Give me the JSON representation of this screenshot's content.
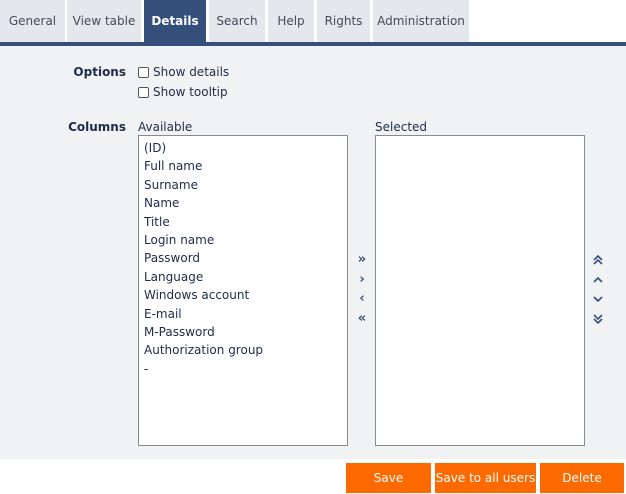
{
  "tabs": [
    {
      "label": "General",
      "active": false
    },
    {
      "label": "View table",
      "active": false
    },
    {
      "label": "Details",
      "active": true
    },
    {
      "label": "Search",
      "active": false
    },
    {
      "label": "Help",
      "active": false
    },
    {
      "label": "Rights",
      "active": false
    },
    {
      "label": "Administration",
      "active": false
    }
  ],
  "options": {
    "label": "Options",
    "show_details": {
      "label": "Show details",
      "checked": false
    },
    "show_tooltip": {
      "label": "Show tooltip",
      "checked": false
    }
  },
  "columns": {
    "label": "Columns",
    "available_caption": "Available",
    "selected_caption": "Selected",
    "available": [
      "(ID)",
      "Full name",
      "Surname",
      "Name",
      "Title",
      "Login name",
      "Password",
      "Language",
      "Windows account",
      "E-mail",
      "M-Password",
      "Authorization group",
      "-"
    ],
    "selected": []
  },
  "movers": {
    "add_all": "»",
    "add": "›",
    "remove": "‹",
    "remove_all": "«"
  },
  "order": {
    "top": "⌃",
    "up": "˄",
    "down": "˅",
    "bottom": "⌄"
  },
  "buttons": {
    "save": "Save",
    "save_all": "Save to all users",
    "delete": "Delete"
  },
  "colors": {
    "accent": "#34507a",
    "action": "#ff6a00",
    "panel": "#f1f2f4"
  }
}
